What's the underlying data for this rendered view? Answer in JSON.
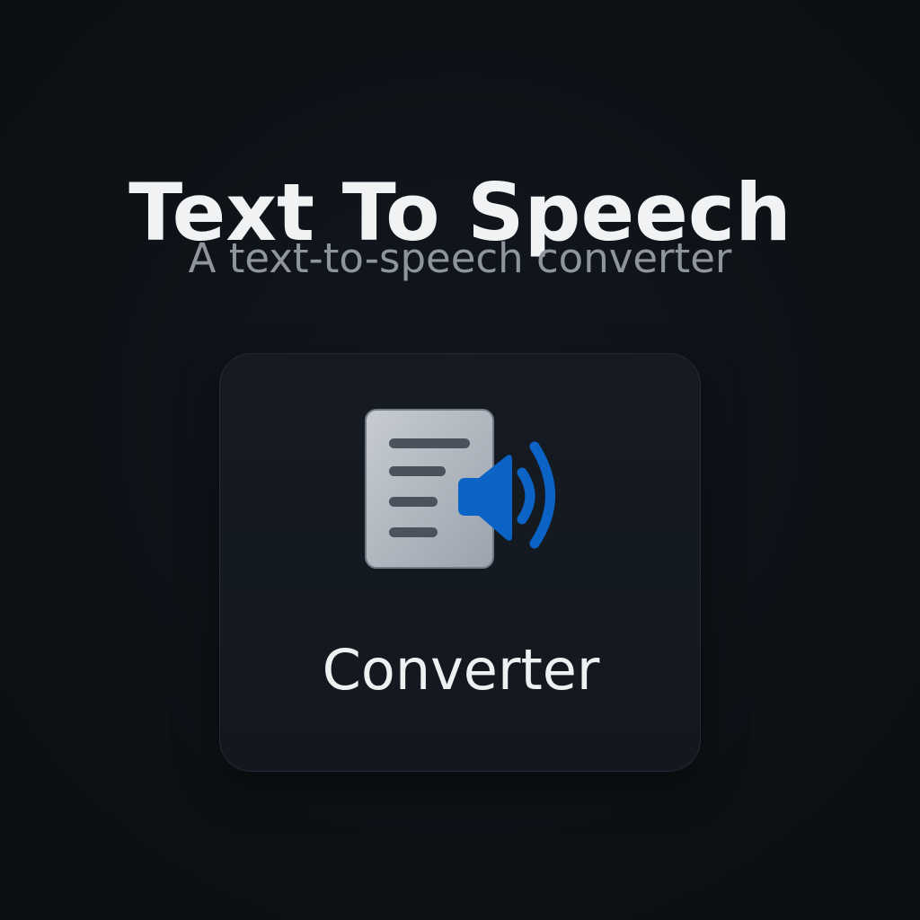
{
  "header": {
    "title": "Text To Speech",
    "subtitle": "A text-to-speech converter"
  },
  "card": {
    "label": "Converter",
    "icon": "text-to-speech-icon"
  },
  "colors": {
    "background": "#0d1014",
    "card": "#151a21",
    "title": "#f1f2f4",
    "subtitle": "#8f959d",
    "document": "#a8afb8",
    "speaker": "#0b63c5"
  }
}
